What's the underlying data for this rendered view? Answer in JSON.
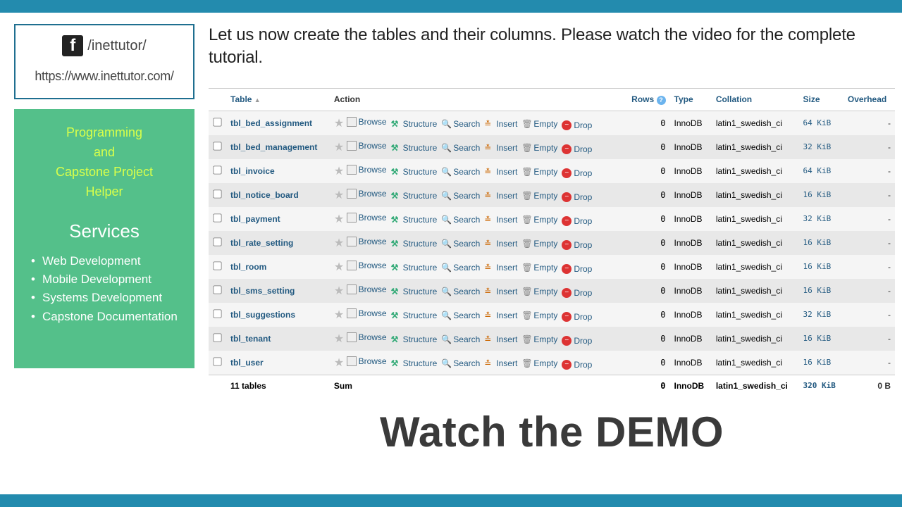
{
  "sidebar": {
    "facebook_handle": "/inettutor/",
    "site_url": "https://www.inettutor.com/",
    "helper_title_l1": "Programming",
    "helper_title_l2": "and",
    "helper_title_l3": "Capstone Project",
    "helper_title_l4": "Helper",
    "services_heading": "Services",
    "services": [
      "Web Development",
      "Mobile Development",
      "Systems Development",
      "Capstone Documentation"
    ]
  },
  "intro_text": "Let us now create the tables and their columns. Please watch the video for the complete tutorial.",
  "table_headers": {
    "table": "Table",
    "action": "Action",
    "rows": "Rows",
    "type": "Type",
    "collation": "Collation",
    "size": "Size",
    "overhead": "Overhead"
  },
  "actions": {
    "browse": "Browse",
    "structure": "Structure",
    "search": "Search",
    "insert": "Insert",
    "empty": "Empty",
    "drop": "Drop"
  },
  "tables": [
    {
      "name": "tbl_bed_assignment",
      "rows": "0",
      "type": "InnoDB",
      "collation": "latin1_swedish_ci",
      "size": "64 KiB",
      "overhead": "-"
    },
    {
      "name": "tbl_bed_management",
      "rows": "0",
      "type": "InnoDB",
      "collation": "latin1_swedish_ci",
      "size": "32 KiB",
      "overhead": "-"
    },
    {
      "name": "tbl_invoice",
      "rows": "0",
      "type": "InnoDB",
      "collation": "latin1_swedish_ci",
      "size": "64 KiB",
      "overhead": "-"
    },
    {
      "name": "tbl_notice_board",
      "rows": "0",
      "type": "InnoDB",
      "collation": "latin1_swedish_ci",
      "size": "16 KiB",
      "overhead": "-"
    },
    {
      "name": "tbl_payment",
      "rows": "0",
      "type": "InnoDB",
      "collation": "latin1_swedish_ci",
      "size": "32 KiB",
      "overhead": "-"
    },
    {
      "name": "tbl_rate_setting",
      "rows": "0",
      "type": "InnoDB",
      "collation": "latin1_swedish_ci",
      "size": "16 KiB",
      "overhead": "-"
    },
    {
      "name": "tbl_room",
      "rows": "0",
      "type": "InnoDB",
      "collation": "latin1_swedish_ci",
      "size": "16 KiB",
      "overhead": "-"
    },
    {
      "name": "tbl_sms_setting",
      "rows": "0",
      "type": "InnoDB",
      "collation": "latin1_swedish_ci",
      "size": "16 KiB",
      "overhead": "-"
    },
    {
      "name": "tbl_suggestions",
      "rows": "0",
      "type": "InnoDB",
      "collation": "latin1_swedish_ci",
      "size": "32 KiB",
      "overhead": "-"
    },
    {
      "name": "tbl_tenant",
      "rows": "0",
      "type": "InnoDB",
      "collation": "latin1_swedish_ci",
      "size": "16 KiB",
      "overhead": "-"
    },
    {
      "name": "tbl_user",
      "rows": "0",
      "type": "InnoDB",
      "collation": "latin1_swedish_ci",
      "size": "16 KiB",
      "overhead": "-"
    }
  ],
  "summary": {
    "count": "11 tables",
    "sum": "Sum",
    "rows": "0",
    "type": "InnoDB",
    "collation": "latin1_swedish_ci",
    "size": "320 KiB",
    "overhead": "0 B"
  },
  "demo_text": "Watch the DEMO"
}
